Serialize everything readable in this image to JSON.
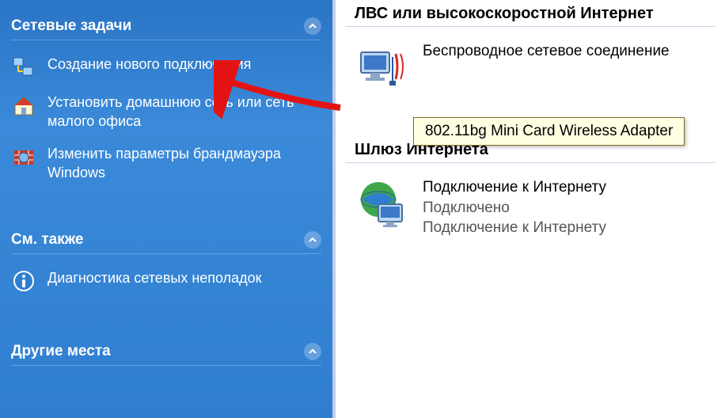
{
  "sidebar": {
    "panels": [
      {
        "title": "Сетевые задачи",
        "items": [
          {
            "label": "Создание нового подключения"
          },
          {
            "label": "Установить домашнюю сеть или сеть малого офиса"
          },
          {
            "label": "Изменить параметры брандмауэра Windows"
          }
        ]
      },
      {
        "title": "См. также",
        "items": [
          {
            "label": "Диагностика сетевых неполадок"
          }
        ]
      },
      {
        "title": "Другие места",
        "items": []
      }
    ]
  },
  "content": {
    "groups": [
      {
        "header": "ЛВС или высокоскоростной Интернет",
        "items": [
          {
            "title": "Беспроводное сетевое соединение",
            "status": ""
          }
        ]
      },
      {
        "header": "Шлюз Интернета",
        "items": [
          {
            "title": "Подключение к Интернету",
            "status": "Подключено",
            "sub": "Подключение к Интернету"
          }
        ]
      }
    ]
  },
  "tooltip": "802.11bg Mini Card Wireless Adapter"
}
